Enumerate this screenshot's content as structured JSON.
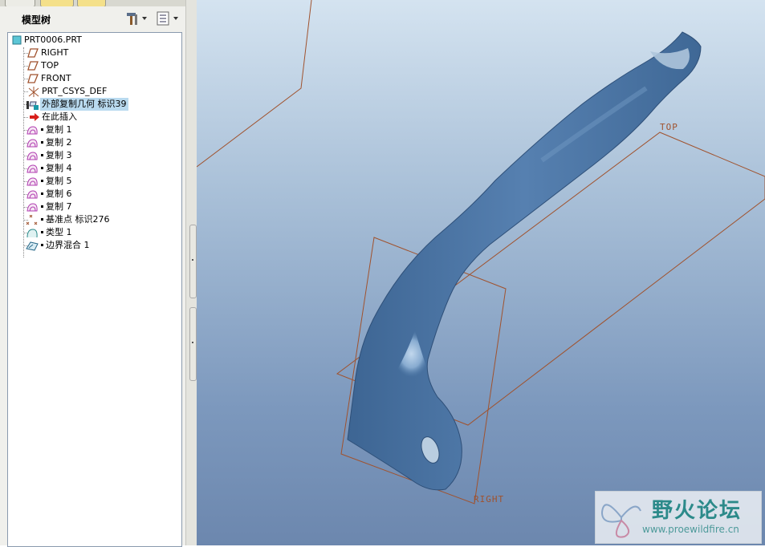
{
  "model_tree": {
    "title": "模型树",
    "items": [
      {
        "label": "PRT0006.PRT",
        "icon": "part-icon"
      },
      {
        "label": "RIGHT",
        "icon": "datum-plane-icon"
      },
      {
        "label": "TOP",
        "icon": "datum-plane-icon"
      },
      {
        "label": "FRONT",
        "icon": "datum-plane-icon"
      },
      {
        "label": "PRT_CSYS_DEF",
        "icon": "csys-icon"
      },
      {
        "label": "外部复制几何 标识39",
        "icon": "external-copy-geom-icon"
      },
      {
        "label": "在此插入",
        "icon": "insert-here-arrow-icon"
      },
      {
        "label": "复制 1",
        "icon": "copy-surface-icon"
      },
      {
        "label": "复制 2",
        "icon": "copy-surface-icon"
      },
      {
        "label": "复制 3",
        "icon": "copy-surface-icon"
      },
      {
        "label": "复制 4",
        "icon": "copy-surface-icon"
      },
      {
        "label": "复制 5",
        "icon": "copy-surface-icon"
      },
      {
        "label": "复制 6",
        "icon": "copy-surface-icon"
      },
      {
        "label": "复制 7",
        "icon": "copy-surface-icon"
      },
      {
        "label": "基准点 标识276",
        "icon": "datum-point-icon"
      },
      {
        "label": "类型 1",
        "icon": "style-surface-icon"
      },
      {
        "label": "边界混合 1",
        "icon": "boundary-blend-icon"
      }
    ]
  },
  "viewport": {
    "datum_labels": {
      "top": "TOP",
      "right": "RIGHT"
    }
  },
  "watermark": {
    "name": "野火论坛",
    "url": "www.proewildfire.cn"
  },
  "colors": {
    "datum": "#a0522d",
    "part": "#4f77a6",
    "selection": "#b9daef",
    "watermark": "#2c8a8a"
  }
}
